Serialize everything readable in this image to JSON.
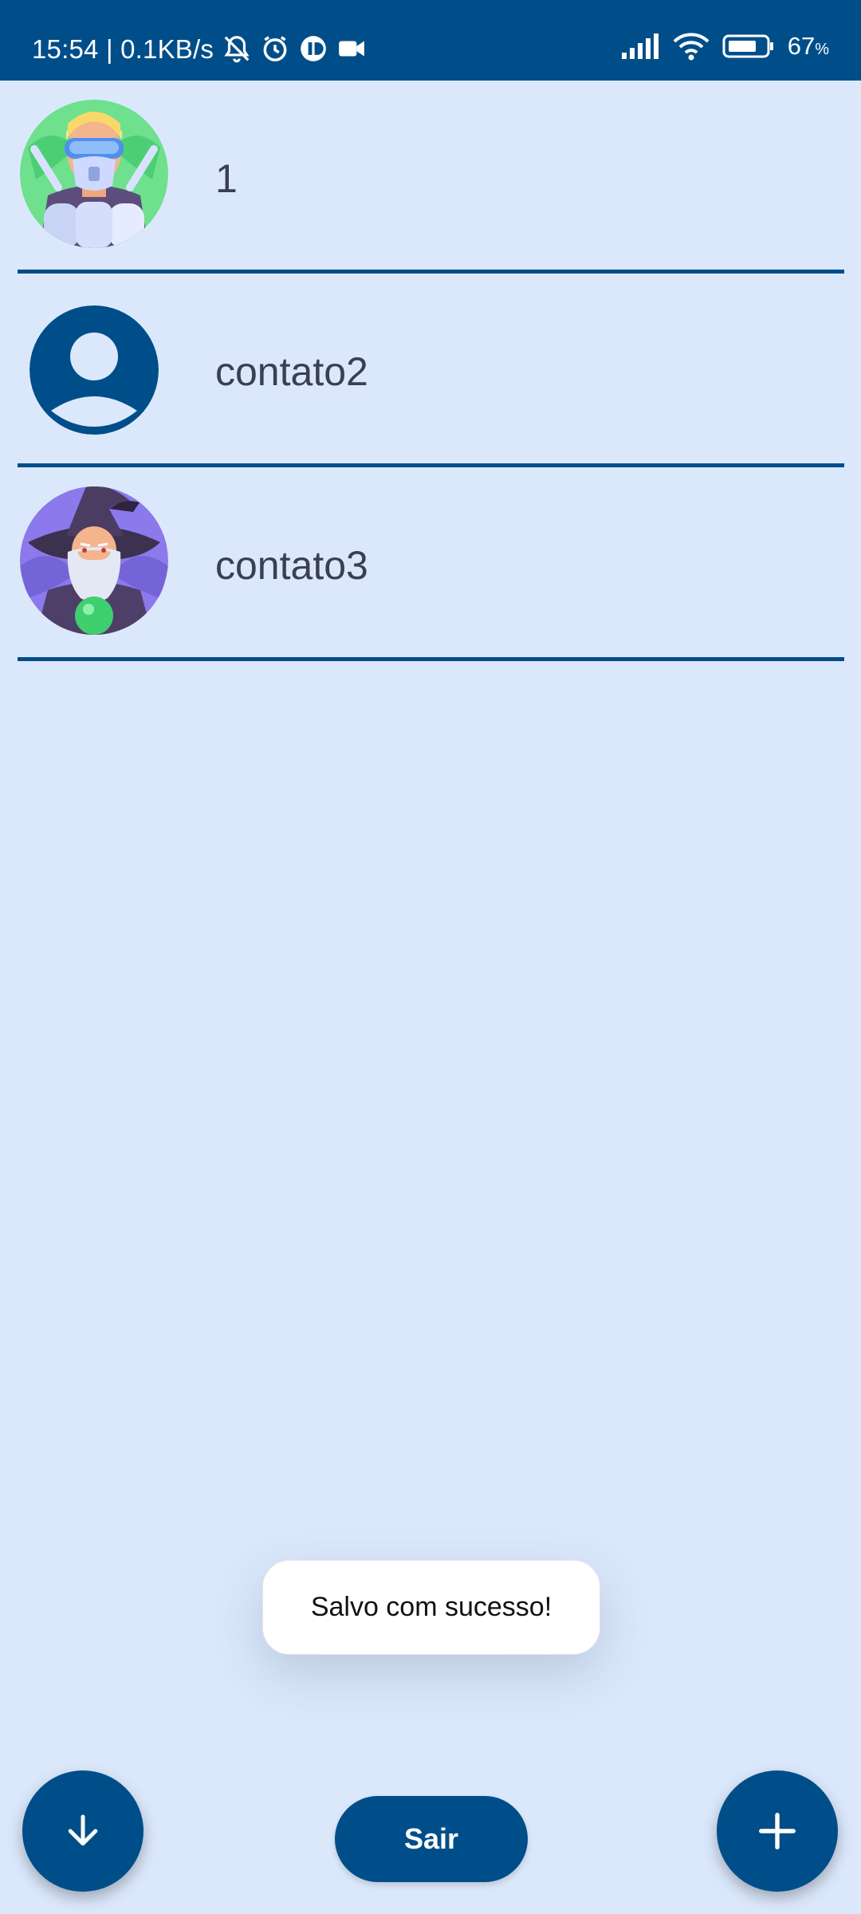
{
  "status_bar": {
    "time_speed": "15:54 | 0.1KB/s",
    "battery_percent": "67",
    "battery_unit": "%",
    "icons": [
      "bell-off-icon",
      "alarm-icon",
      "app-icon",
      "video-icon",
      "signal-icon",
      "wifi-icon",
      "battery-icon"
    ]
  },
  "contacts": [
    {
      "name": "1",
      "avatar": "robot-avatar"
    },
    {
      "name": "contato2",
      "avatar": "default-person-avatar"
    },
    {
      "name": "contato3",
      "avatar": "wizard-avatar"
    }
  ],
  "toast": {
    "message": "Salvo com sucesso!"
  },
  "bottom": {
    "sort_icon": "arrow-down-icon",
    "exit_label": "Sair",
    "add_icon": "plus-icon"
  },
  "colors": {
    "primary": "#004e89",
    "background": "#dbe8fb",
    "text": "#3a3f52"
  }
}
